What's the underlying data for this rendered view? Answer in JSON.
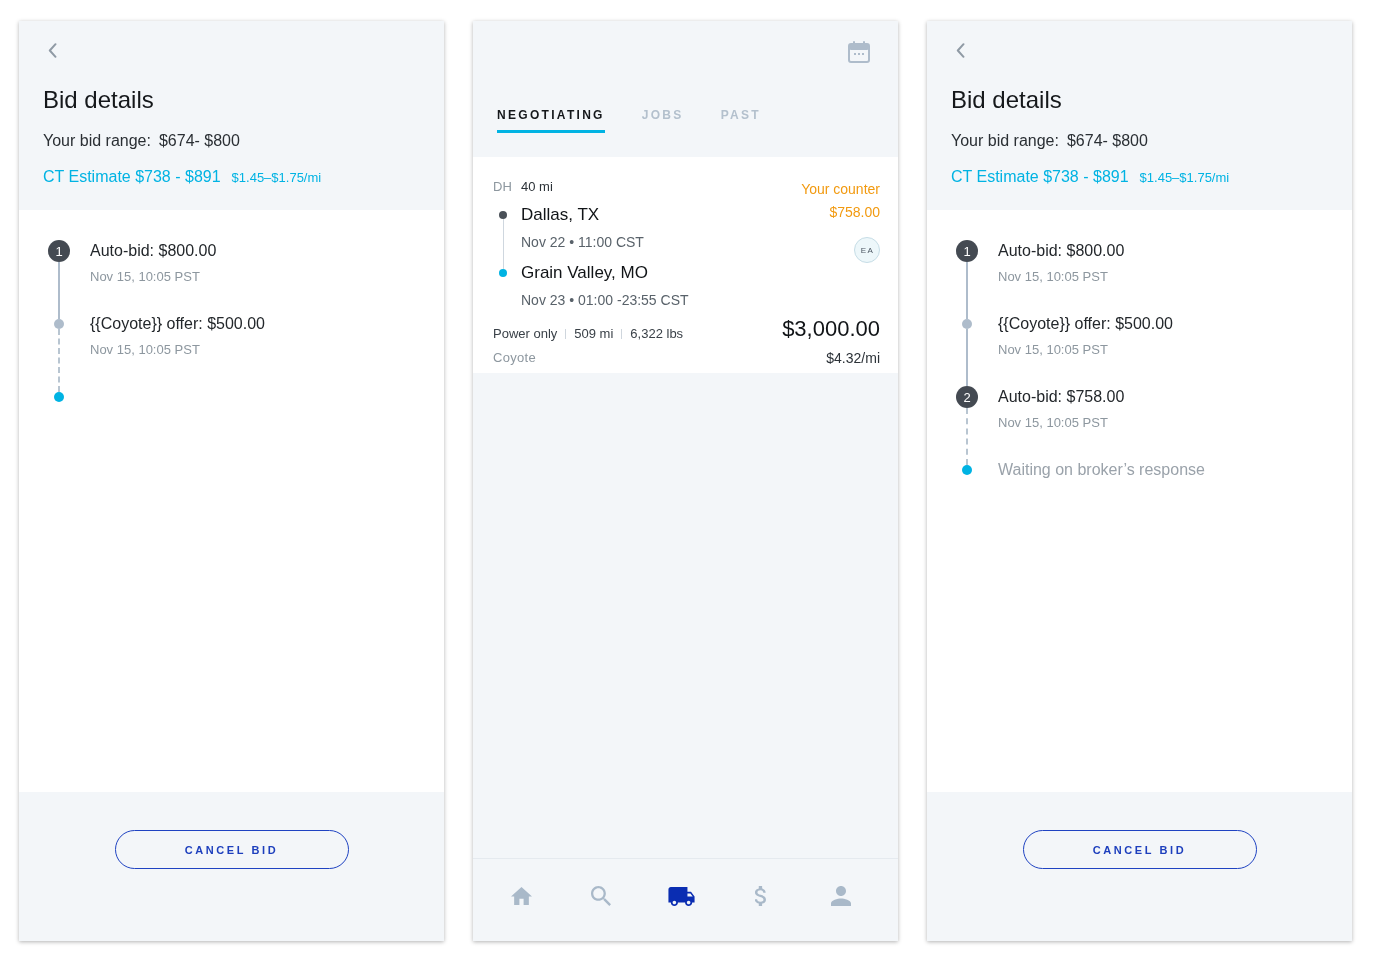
{
  "screens": [
    {
      "kind": "bid_details",
      "title": "Bid details",
      "bid_range": {
        "label": "Your bid range:",
        "value": "$674- $800"
      },
      "estimate": {
        "range": "CT Estimate $738 - $891",
        "per_mile": "$1.45–$1.75/mi"
      },
      "timeline": [
        {
          "kind": "numbered",
          "number": "1",
          "text": "Auto-bid: $800.00",
          "time": "Nov 15, 10:05 PST"
        },
        {
          "kind": "offer",
          "text": "{{Coyote}} offer: $500.00",
          "time": "Nov 15, 10:05 PST"
        },
        {
          "kind": "pending"
        }
      ],
      "button": "CANCEL BID"
    },
    {
      "kind": "loads",
      "tabs": [
        {
          "label": "NEGOTIATING",
          "selected": true
        },
        {
          "label": "JOBS",
          "selected": false
        },
        {
          "label": "PAST",
          "selected": false
        }
      ],
      "load": {
        "deadhead": {
          "label": "DH",
          "value": "40 mi"
        },
        "stops": [
          {
            "kind": "origin",
            "city": "Dallas, TX",
            "time": "Nov 22 • 11:00 CST"
          },
          {
            "kind": "destination",
            "city": "Grain Valley, MO",
            "time": "Nov 23 • 01:00 -23:55 CST"
          }
        ],
        "details": [
          "Power only",
          "509 mi",
          "6,322 lbs"
        ],
        "broker": "Coyote",
        "counter": {
          "label": "Your counter",
          "value": "$758.00"
        },
        "avatar": "EA",
        "price": "$3,000.00",
        "rate": "$4.32/mi"
      },
      "nav": [
        {
          "kind": "home",
          "selected": false
        },
        {
          "kind": "search",
          "selected": false
        },
        {
          "kind": "truck",
          "selected": true
        },
        {
          "kind": "dollar",
          "selected": false
        },
        {
          "kind": "profile",
          "selected": false
        }
      ]
    },
    {
      "kind": "bid_details",
      "title": "Bid details",
      "bid_range": {
        "label": "Your bid range:",
        "value": "$674- $800"
      },
      "estimate": {
        "range": "CT Estimate $738 - $891",
        "per_mile": "$1.45–$1.75/mi"
      },
      "timeline": [
        {
          "kind": "numbered",
          "number": "1",
          "text": "Auto-bid: $800.00",
          "time": "Nov 15, 10:05 PST"
        },
        {
          "kind": "offer",
          "text": "{{Coyote}} offer: $500.00",
          "time": "Nov 15, 10:05 PST"
        },
        {
          "kind": "numbered",
          "number": "2",
          "text": "Auto-bid: $758.00",
          "time": "Nov 15, 10:05 PST"
        },
        {
          "kind": "pending",
          "text": "Waiting on broker’s response"
        }
      ],
      "button": "CANCEL BID"
    }
  ]
}
